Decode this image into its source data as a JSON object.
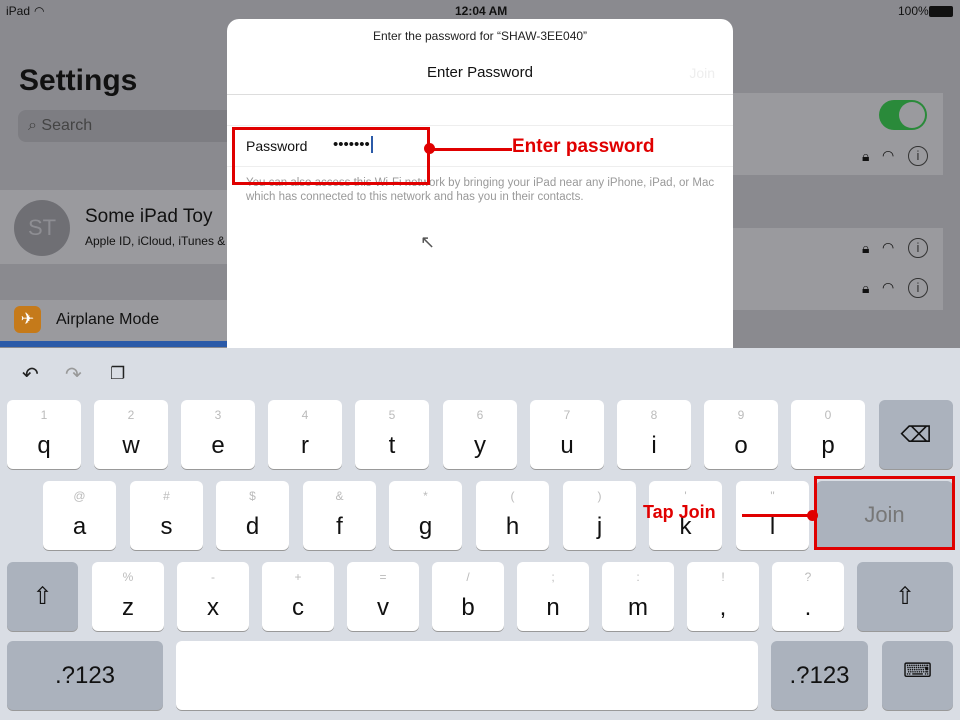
{
  "status_bar": {
    "device": "iPad",
    "time": "12:04 AM",
    "battery": "100%"
  },
  "settings": {
    "title": "Settings",
    "search_placeholder": "Search",
    "account_initials": "ST",
    "account_name": "Some iPad Toy",
    "account_sub": "Apple ID, iCloud, iTunes &",
    "airplane": "Airplane Mode",
    "wifi_toggle_on": true
  },
  "dialog": {
    "prompt": "Enter the password for “SHAW-3EE040”",
    "title": "Enter Password",
    "join": "Join",
    "field_label": "Password",
    "field_value": "•••••••",
    "hint": "You can also access this Wi-Fi network by bringing your iPad near any iPhone, iPad, or Mac which has connected to this network and has you in their contacts."
  },
  "annotations": {
    "enter_password": "Enter password",
    "tap_join": "Tap Join",
    "color": "#e00000"
  },
  "keyboard": {
    "row1": [
      [
        "1",
        "q"
      ],
      [
        "2",
        "w"
      ],
      [
        "3",
        "e"
      ],
      [
        "4",
        "r"
      ],
      [
        "5",
        "t"
      ],
      [
        "6",
        "y"
      ],
      [
        "7",
        "u"
      ],
      [
        "8",
        "i"
      ],
      [
        "9",
        "o"
      ],
      [
        "0",
        "p"
      ]
    ],
    "row2": [
      [
        "@",
        "a"
      ],
      [
        "#",
        "s"
      ],
      [
        "$",
        "d"
      ],
      [
        "&",
        "f"
      ],
      [
        "*",
        "g"
      ],
      [
        "(",
        "h"
      ],
      [
        ")",
        "j"
      ],
      [
        "'",
        "k"
      ],
      [
        "\"",
        "l"
      ]
    ],
    "row3": [
      [
        "%",
        "z"
      ],
      [
        "-",
        "x"
      ],
      [
        "+",
        "c"
      ],
      [
        "=",
        "v"
      ],
      [
        "/",
        "b"
      ],
      [
        ";",
        "n"
      ],
      [
        ":",
        "m"
      ],
      [
        "!",
        ","
      ],
      [
        "?",
        "."
      ]
    ],
    "join": "Join",
    "numbers": ".?123",
    "backspace_icon": "backspace-icon",
    "shift_icon": "shift-icon",
    "dismiss_icon": "keyboard-dismiss-icon"
  }
}
